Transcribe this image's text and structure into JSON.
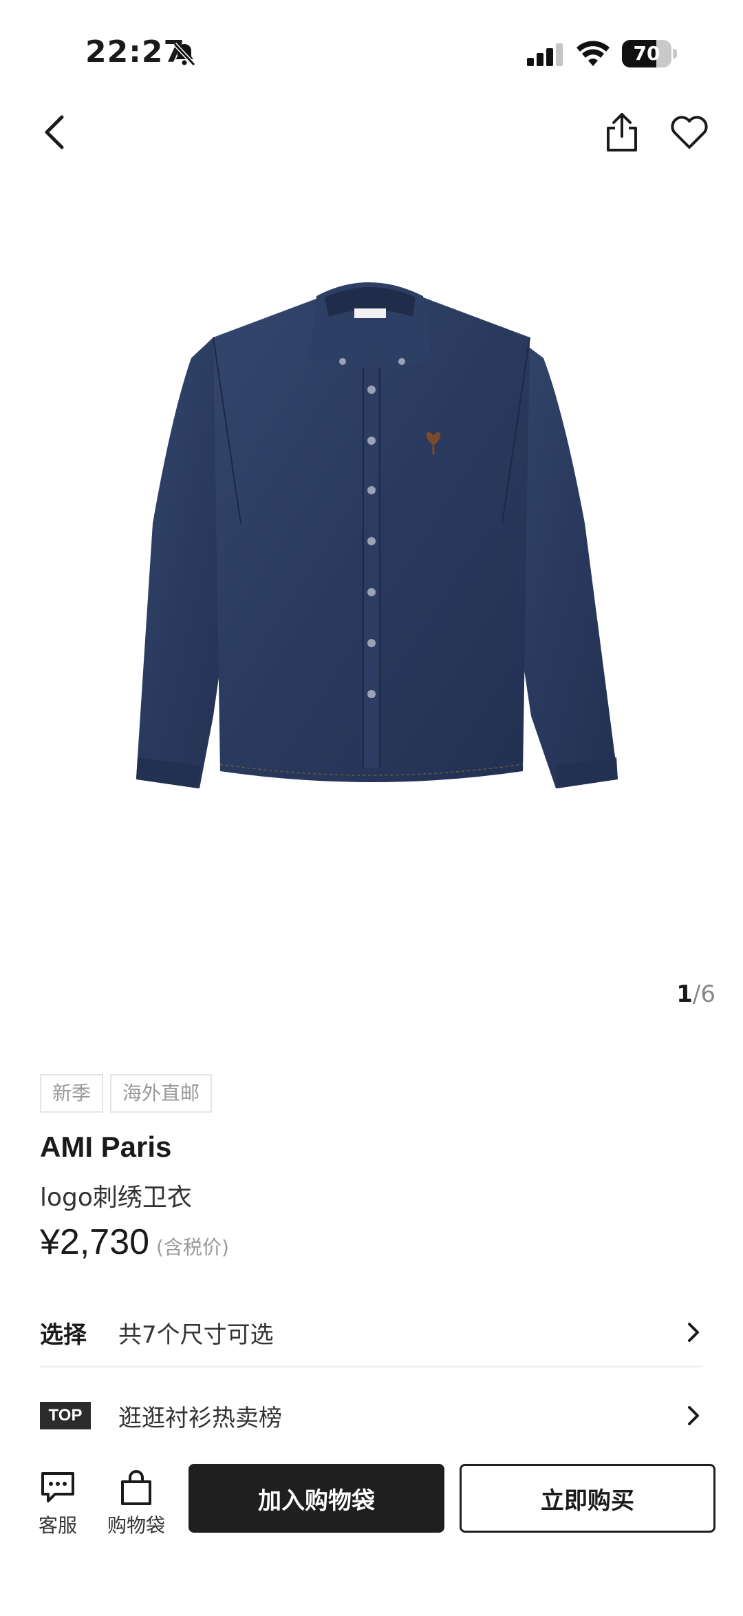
{
  "status_bar": {
    "time": "22:27",
    "battery_level": "70",
    "battery_fraction": 0.7
  },
  "nav": {
    "back_icon": "chevron-left-icon",
    "share_icon": "share-icon",
    "favorite_icon": "heart-icon"
  },
  "gallery": {
    "current": "1",
    "separator": "/",
    "total": "6"
  },
  "product": {
    "tags": [
      "新季",
      "海外直邮"
    ],
    "brand": "AMI Paris",
    "name": "logo刺绣卫衣",
    "price": "¥2,730",
    "price_note": "(含税价)"
  },
  "options": {
    "select_label": "选择",
    "select_text": "共7个尺寸可选",
    "top_badge": "TOP",
    "top_text": "逛逛衬衫热卖榜"
  },
  "bottom_bar": {
    "service_label": "客服",
    "bag_label": "购物袋",
    "add_to_bag": "加入购物袋",
    "buy_now": "立即购买"
  },
  "colors": {
    "primary_button": "#1f1f1f",
    "denim": "#2a3a5e"
  }
}
